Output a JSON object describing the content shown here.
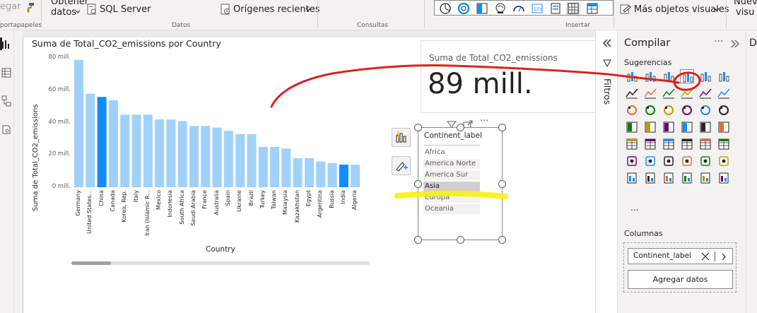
{
  "ribbon": {
    "cut_text": "egar",
    "portapapeles_label": "portapapeles",
    "obtener_line1": "Obtener",
    "obtener_line2": "datos",
    "sql_server_label": "SQL Server",
    "datos_label": "Datos",
    "origenes_label": "Orígenes recientes",
    "consultas_label": "Consultas",
    "insertar_label": "Insertar",
    "mas_visuales_label": "Más objetos visuales",
    "nuevo_line1": "Nuevo",
    "nuevo_line2": "visu"
  },
  "canvas": {
    "bar_chart": {
      "title": "Suma de Total_CO2_emissions por Country",
      "ylabel": "Suma de Total_CO2_emissions",
      "xlabel": "Country"
    },
    "card": {
      "label": "Suma de Total_CO2_emissions",
      "value": "89 mill."
    },
    "slicer": {
      "header": "Continent_label",
      "items": [
        {
          "label": "Africa"
        },
        {
          "label": "America Norte"
        },
        {
          "label": "America Sur"
        },
        {
          "label": "Asia"
        },
        {
          "label": "Europa"
        },
        {
          "label": "Oceania"
        }
      ],
      "selected_index": 3
    }
  },
  "chart_data": {
    "type": "bar",
    "title": "Suma de Total_CO2_emissions por Country",
    "xlabel": "Country",
    "ylabel": "Suma de Total_CO2_emissions",
    "categories": [
      "Germany",
      "United States...",
      "China",
      "Canada",
      "Korea, Rep.",
      "Italy",
      "Iran (Islamic R...",
      "Mexico",
      "Indonesia",
      "South Africa",
      "Saudi Arabia",
      "France",
      "Australia",
      "Spain",
      "Ukraine",
      "Brazil",
      "Turkey",
      "Taiwan",
      "Malaysia",
      "Kazakhstan",
      "Egypt",
      "Argentina",
      "Russia",
      "India",
      "Algeria"
    ],
    "values": [
      79,
      58,
      56,
      54,
      45,
      45,
      45,
      42,
      42,
      41,
      38,
      38,
      37,
      35,
      33,
      33,
      25,
      25,
      24,
      18,
      18,
      16,
      15,
      14,
      14
    ],
    "highlighted": [
      "China",
      "India"
    ],
    "yticks": [
      {
        "v": 0,
        "label": "0 mill."
      },
      {
        "v": 20,
        "label": "20 mill."
      },
      {
        "v": 40,
        "label": "40 mill."
      },
      {
        "v": 60,
        "label": "60 mill."
      },
      {
        "v": 80,
        "label": "80 mill."
      }
    ],
    "ylim": [
      0,
      85
    ],
    "grid": false,
    "colors": {
      "normal": "#a0d1fb",
      "highlight": "#118dff"
    }
  },
  "filters_pane": {
    "label": "Filtros"
  },
  "build_pane": {
    "title": "Compilar",
    "suggestions_label": "Sugerencias",
    "columns_label": "Columnas",
    "field_name": "Continent_label",
    "add_data_label": "Agregar datos",
    "more_label": "...",
    "more_dots": "···"
  },
  "colors": {
    "accent": "#118dff",
    "annotation_red": "#d9231f",
    "annotation_yellow": "#f5f014"
  }
}
